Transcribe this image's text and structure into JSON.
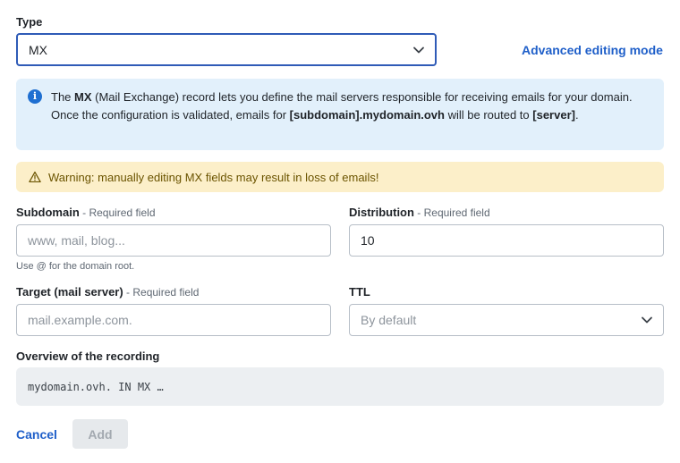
{
  "type_field": {
    "label": "Type",
    "value": "MX"
  },
  "advanced_link": "Advanced editing mode",
  "info": {
    "p1": "The ",
    "b1": "MX",
    "p2": " (Mail Exchange) record lets you define the mail servers responsible for receiving emails for your domain. Once the configuration is validated, emails for ",
    "b2": "[subdomain].mydomain.ovh",
    "p3": " will be routed to ",
    "b3": "[server]",
    "p4": "."
  },
  "warning": "Warning: manually editing MX fields may result in loss of emails!",
  "subdomain": {
    "label": "Subdomain",
    "required": " - Required field",
    "placeholder": "www, mail, blog...",
    "hint": "Use @ for the domain root."
  },
  "distribution": {
    "label": "Distribution",
    "required": " - Required field",
    "value": "10"
  },
  "target": {
    "label": "Target (mail server)",
    "required": " - Required field",
    "placeholder": "mail.example.com."
  },
  "ttl": {
    "label": "TTL",
    "value": "By default"
  },
  "overview": {
    "label": "Overview of the recording",
    "value": "mydomain.ovh. IN MX …"
  },
  "actions": {
    "cancel": "Cancel",
    "add": "Add"
  },
  "colors": {
    "accent": "#1f5fc9",
    "info_bg": "#e2f0fb",
    "warning_bg": "#fcefc9"
  }
}
